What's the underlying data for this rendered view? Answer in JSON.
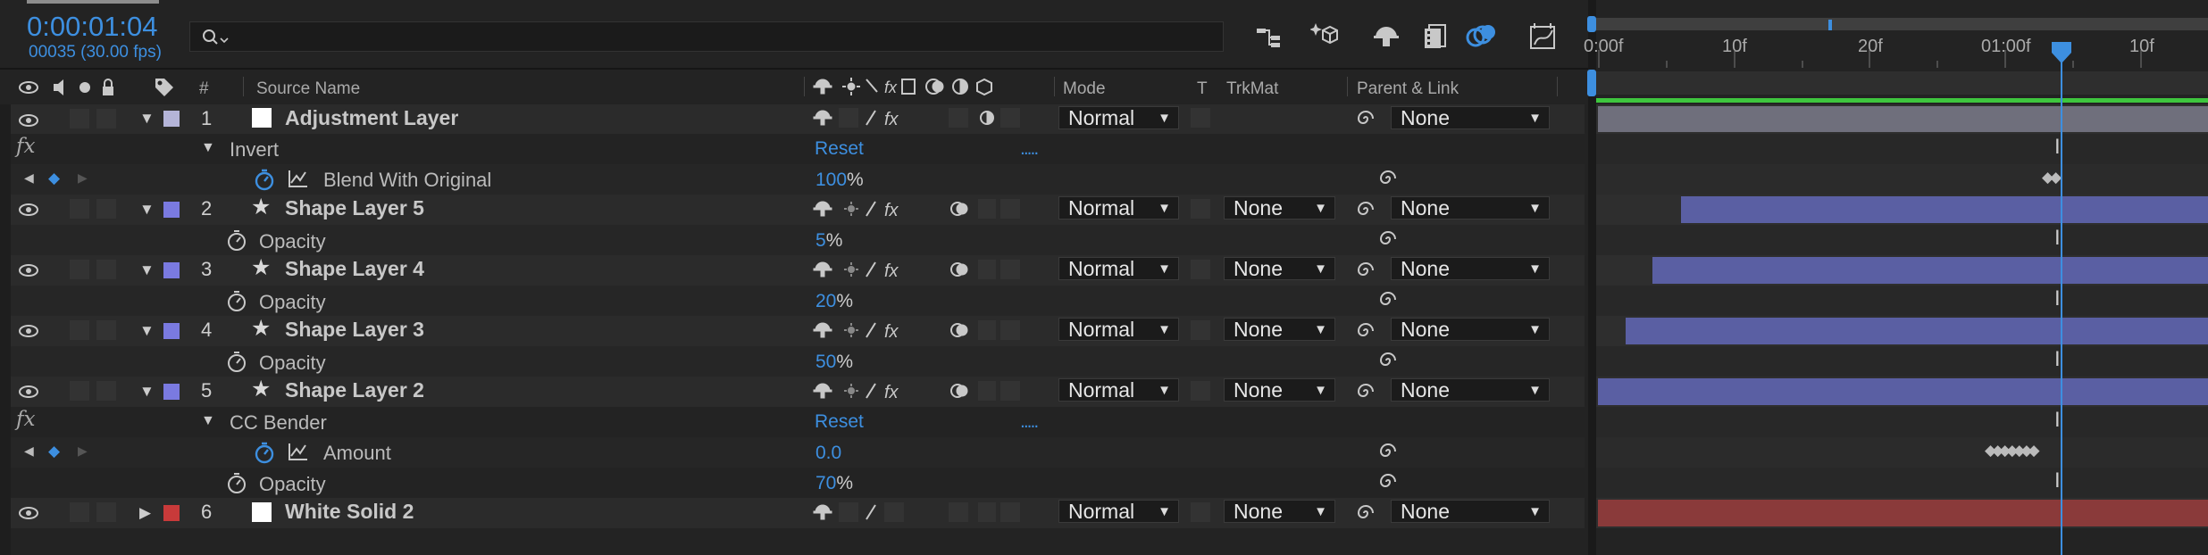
{
  "header": {
    "timecode": "0:00:01:04",
    "frame_info": "00035 (30.00 fps)",
    "search_placeholder": ""
  },
  "toolbar_icons": [
    "composition-flowchart-icon",
    "draft-3d-icon",
    "shy-layers-icon",
    "frame-blending-icon",
    "motion-blur-icon",
    "graph-editor-icon"
  ],
  "columns": {
    "number": "#",
    "source_name": "Source Name",
    "mode": "Mode",
    "t": "T",
    "trkmat": "TrkMat",
    "parent": "Parent & Link"
  },
  "ruler": {
    "labels": [
      "0:00f",
      "10f",
      "20f",
      "01:00f",
      "10f"
    ]
  },
  "rows": [
    {
      "kind": "layer",
      "num": "1",
      "name": "Adjustment Layer",
      "color": "#b4b4d8",
      "mode": "Normal",
      "trkmat": "",
      "parent": "None",
      "expanded": true
    },
    {
      "kind": "effect",
      "name": "Invert",
      "reset": "Reset",
      "dots": "....."
    },
    {
      "kind": "prop",
      "name": "Blend With Original",
      "value": "100",
      "unit": "%",
      "stopwatch": true
    },
    {
      "kind": "layer",
      "num": "2",
      "name": "Shape Layer 5",
      "color": "#7a7ae0",
      "mode": "Normal",
      "trkmat": "None",
      "parent": "None",
      "expanded": true
    },
    {
      "kind": "prop",
      "name": "Opacity",
      "value": "5",
      "unit": "%",
      "stopwatch": false
    },
    {
      "kind": "layer",
      "num": "3",
      "name": "Shape Layer 4",
      "color": "#7a7ae0",
      "mode": "Normal",
      "trkmat": "None",
      "parent": "None",
      "expanded": true
    },
    {
      "kind": "prop",
      "name": "Opacity",
      "value": "20",
      "unit": "%",
      "stopwatch": false
    },
    {
      "kind": "layer",
      "num": "4",
      "name": "Shape Layer 3",
      "color": "#7a7ae0",
      "mode": "Normal",
      "trkmat": "None",
      "parent": "None",
      "expanded": true
    },
    {
      "kind": "prop",
      "name": "Opacity",
      "value": "50",
      "unit": "%",
      "stopwatch": false
    },
    {
      "kind": "layer",
      "num": "5",
      "name": "Shape Layer 2",
      "color": "#7a7ae0",
      "mode": "Normal",
      "trkmat": "None",
      "parent": "None",
      "expanded": true
    },
    {
      "kind": "effect",
      "name": "CC Bender",
      "reset": "Reset",
      "dots": "....."
    },
    {
      "kind": "prop",
      "name": "Amount",
      "value": "0.0",
      "unit": "",
      "stopwatch": true
    },
    {
      "kind": "prop",
      "name": "Opacity",
      "value": "70",
      "unit": "%",
      "stopwatch": false
    },
    {
      "kind": "layer",
      "num": "6",
      "name": "White Solid 2",
      "color": "#c83a3a",
      "mode": "Normal",
      "trkmat": "None",
      "parent": "None",
      "expanded": false
    }
  ],
  "colors": {
    "accent": "#3d8fe0",
    "layer_bar_adjustment": "#6f6f7c",
    "layer_bar_shape": "#5a5fa3",
    "layer_bar_solid": "#8a3a3a",
    "work_area": "#3ec63e",
    "playhead": "#3d8fe0"
  }
}
